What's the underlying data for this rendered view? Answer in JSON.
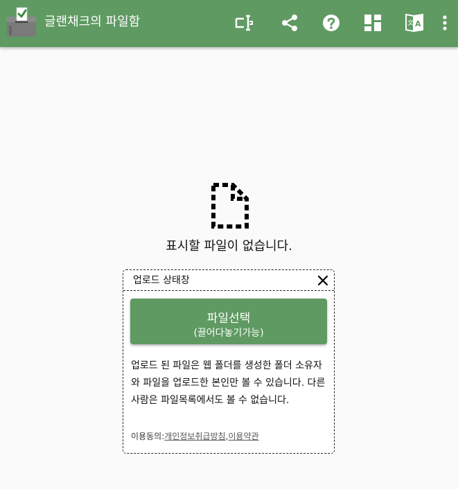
{
  "appbar": {
    "title": "글랜채크의 파일함",
    "background": "#5f9a62",
    "logo_icon": "ballot-box-icon",
    "tools": [
      {
        "icon": "text-select-icon"
      },
      {
        "icon": "share-icon"
      },
      {
        "icon": "help-icon"
      },
      {
        "icon": "dashboard-icon"
      },
      {
        "icon": "translate-icon"
      },
      {
        "icon": "more-vert-icon"
      }
    ]
  },
  "main": {
    "empty_icon": "file-dashed-icon",
    "empty_text": "표시할 파일이 없습니다."
  },
  "upload": {
    "title": "업로드 상태창",
    "close_icon": "close-icon",
    "button_line1": "파일선택",
    "button_line2": "(끌어다놓기가능)",
    "notice": "업로드 된 파일은 웹 폴더를 생성한 폴더 소유자와 파일을 업로드한 본인만 볼 수 있습니다. 다른 사람은 파일목록에서도 볼 수 없습니다.",
    "consent_label": "이용동의:",
    "privacy_link": "개인정보취급방침",
    "separator": ",",
    "terms_link": "이용약관"
  }
}
